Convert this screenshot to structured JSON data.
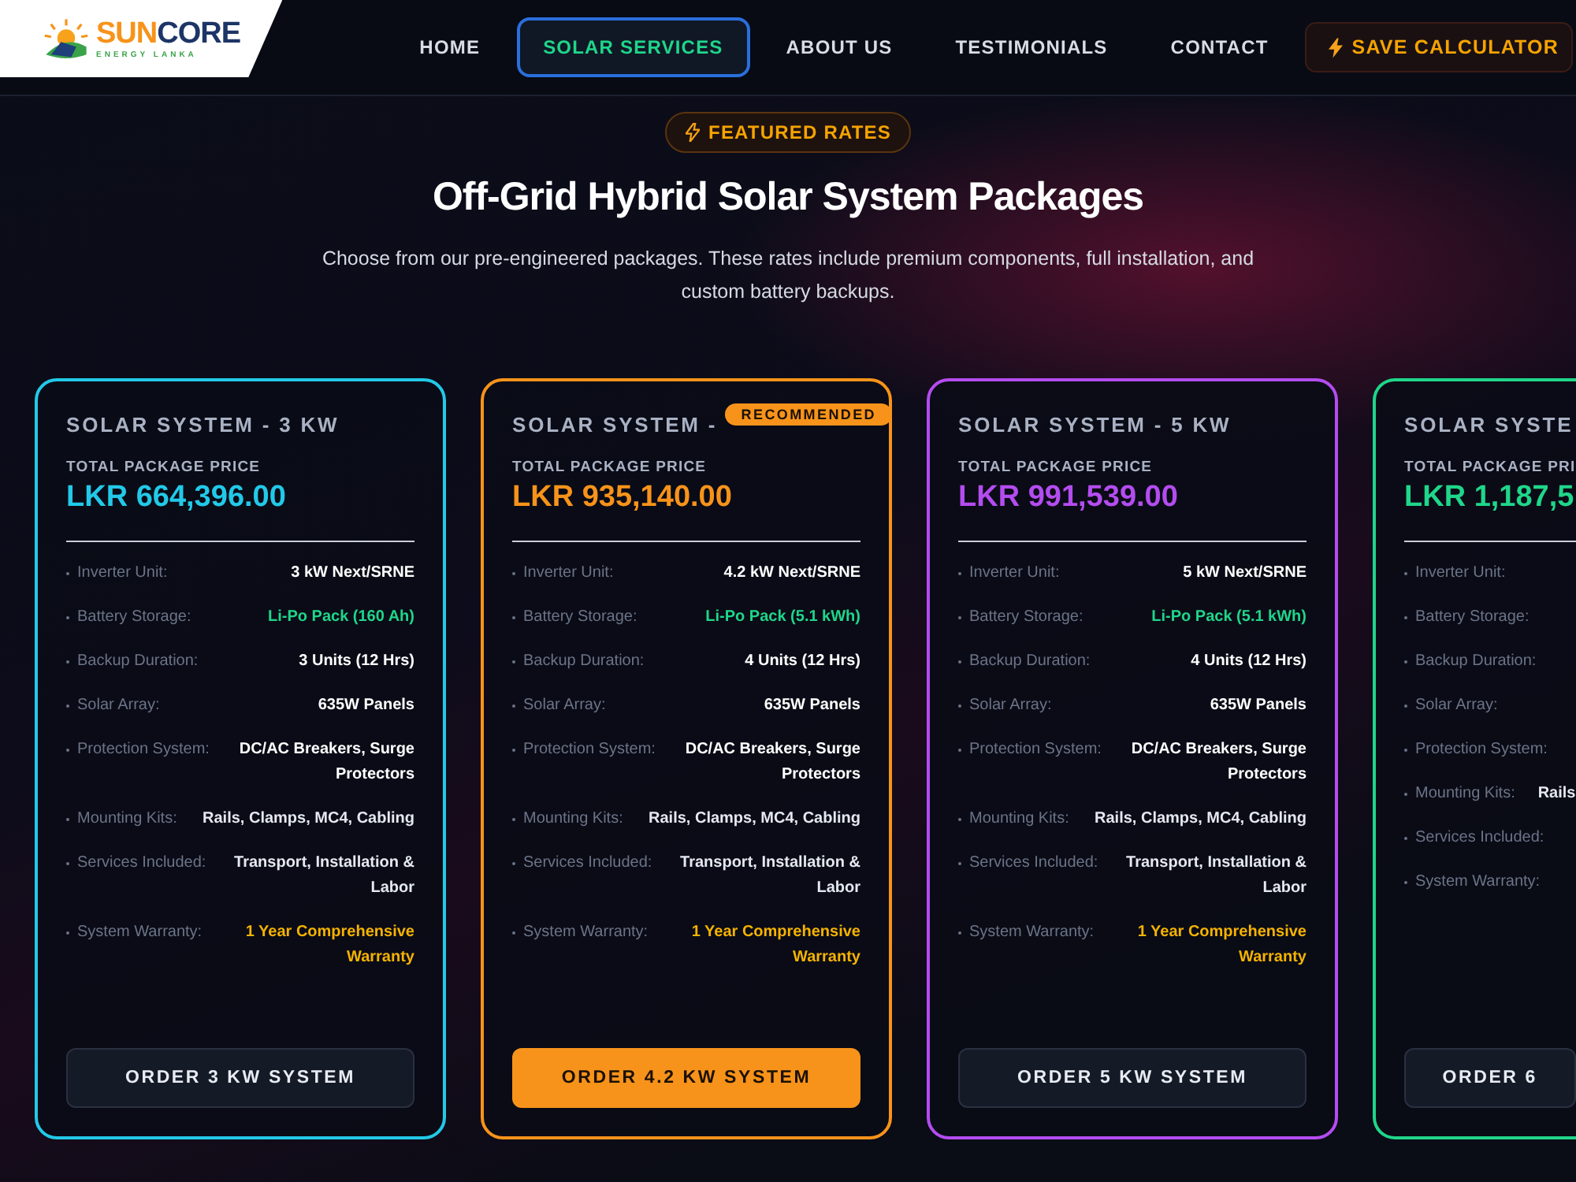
{
  "logo": {
    "brand_a": "SUN",
    "brand_b": "CORE",
    "sub": "ENERGY LANKA"
  },
  "nav": [
    {
      "label": "HOME",
      "selected": false
    },
    {
      "label": "SOLAR SERVICES",
      "selected": true
    },
    {
      "label": "ABOUT US",
      "selected": false
    },
    {
      "label": "TESTIMONIALS",
      "selected": false
    },
    {
      "label": "CONTACT",
      "selected": false
    }
  ],
  "cta": {
    "label": "SAVE CALCULATOR"
  },
  "hero": {
    "badge": "FEATURED RATES",
    "title": "Off-Grid Hybrid Solar System Packages",
    "subtitle": "Choose from our pre-engineered packages. These rates include premium components, full installation, and custom battery backups."
  },
  "packages": [
    {
      "title": "SOLAR SYSTEM - 3 KW",
      "color": "#22c9e8",
      "recommended": false,
      "price_label": "TOTAL PACKAGE PRICE",
      "price": "LKR 664,396.00",
      "button": "ORDER 3 KW SYSTEM",
      "specs": [
        {
          "label": "Inverter Unit:",
          "value": "3 kW Next/SRNE",
          "kind": "plain"
        },
        {
          "label": "Battery Storage:",
          "value": "Li-Po Pack (160 Ah)",
          "kind": "battery"
        },
        {
          "label": "Backup Duration:",
          "value": "3 Units (12 Hrs)",
          "kind": "plain"
        },
        {
          "label": "Solar Array:",
          "value": "635W Panels",
          "kind": "plain"
        },
        {
          "label": "Protection System:",
          "value": "DC/AC Breakers, Surge Protectors",
          "kind": "plain"
        },
        {
          "label": "Mounting Kits:",
          "value": "Rails, Clamps, MC4, Cabling",
          "kind": "light"
        },
        {
          "label": "Services Included:",
          "value": "Transport, Installation & Labor",
          "kind": "light"
        },
        {
          "label": "System Warranty:",
          "value": "1 Year Comprehensive Warranty",
          "kind": "warranty"
        }
      ]
    },
    {
      "title": "SOLAR SYSTEM -",
      "color": "#f7931a",
      "recommended": true,
      "badge": "RECOMMENDED",
      "price_label": "TOTAL PACKAGE PRICE",
      "price": "LKR 935,140.00",
      "button": "ORDER 4.2 KW SYSTEM",
      "specs": [
        {
          "label": "Inverter Unit:",
          "value": "4.2 kW Next/SRNE",
          "kind": "plain"
        },
        {
          "label": "Battery Storage:",
          "value": "Li-Po Pack (5.1 kWh)",
          "kind": "battery"
        },
        {
          "label": "Backup Duration:",
          "value": "4 Units (12 Hrs)",
          "kind": "plain"
        },
        {
          "label": "Solar Array:",
          "value": "635W Panels",
          "kind": "plain"
        },
        {
          "label": "Protection System:",
          "value": "DC/AC Breakers, Surge Protectors",
          "kind": "plain"
        },
        {
          "label": "Mounting Kits:",
          "value": "Rails, Clamps, MC4, Cabling",
          "kind": "light"
        },
        {
          "label": "Services Included:",
          "value": "Transport, Installation & Labor",
          "kind": "light"
        },
        {
          "label": "System Warranty:",
          "value": "1 Year Comprehensive Warranty",
          "kind": "warranty"
        }
      ]
    },
    {
      "title": "SOLAR SYSTEM - 5 KW",
      "color": "#b44cf0",
      "recommended": false,
      "price_label": "TOTAL PACKAGE PRICE",
      "price": "LKR 991,539.00",
      "button": "ORDER 5 KW SYSTEM",
      "specs": [
        {
          "label": "Inverter Unit:",
          "value": "5 kW Next/SRNE",
          "kind": "plain"
        },
        {
          "label": "Battery Storage:",
          "value": "Li-Po Pack (5.1 kWh)",
          "kind": "battery"
        },
        {
          "label": "Backup Duration:",
          "value": "4 Units (12 Hrs)",
          "kind": "plain"
        },
        {
          "label": "Solar Array:",
          "value": "635W Panels",
          "kind": "plain"
        },
        {
          "label": "Protection System:",
          "value": "DC/AC Breakers, Surge Protectors",
          "kind": "plain"
        },
        {
          "label": "Mounting Kits:",
          "value": "Rails, Clamps, MC4, Cabling",
          "kind": "light"
        },
        {
          "label": "Services Included:",
          "value": "Transport, Installation & Labor",
          "kind": "light"
        },
        {
          "label": "System Warranty:",
          "value": "1 Year Comprehensive Warranty",
          "kind": "warranty"
        }
      ]
    },
    {
      "title": "SOLAR SYSTE",
      "color": "#1fd68a",
      "recommended": false,
      "price_label": "TOTAL PACKAGE PRI",
      "price": "LKR 1,187,5",
      "button": "ORDER 6",
      "specs": [
        {
          "label": "Inverter Unit:"
        },
        {
          "label": "Battery Storage:"
        },
        {
          "label": "Backup Duration:"
        },
        {
          "label": "Solar Array:"
        },
        {
          "label": "Protection System:"
        },
        {
          "label": "Mounting Kits:",
          "value": "Rails",
          "kind": "light"
        },
        {
          "label": "Services Included:"
        },
        {
          "label": "System Warranty:"
        }
      ]
    }
  ]
}
